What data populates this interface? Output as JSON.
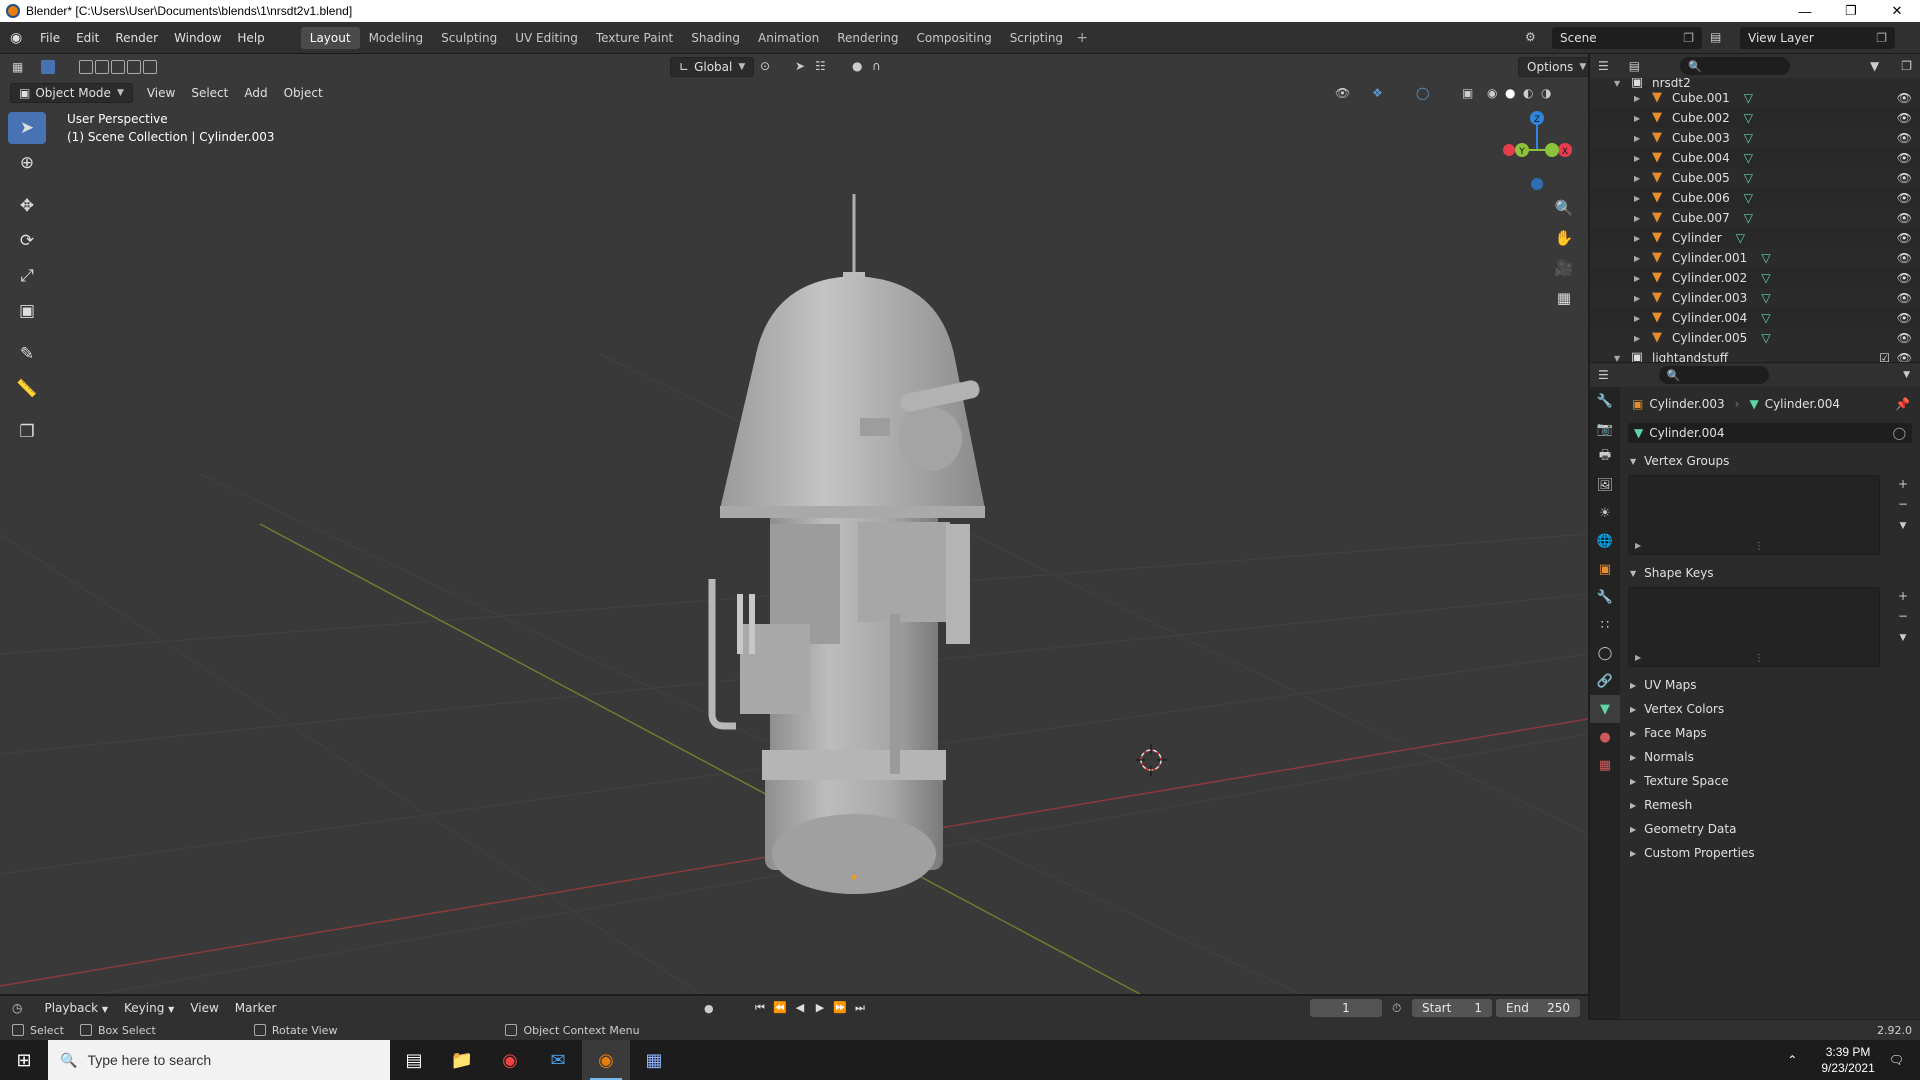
{
  "window": {
    "title": "Blender* [C:\\Users\\User\\Documents\\blends\\1\\nrsdt2v1.blend]"
  },
  "menu": [
    "File",
    "Edit",
    "Render",
    "Window",
    "Help"
  ],
  "workspaces": [
    "Layout",
    "Modeling",
    "Sculpting",
    "UV Editing",
    "Texture Paint",
    "Shading",
    "Animation",
    "Rendering",
    "Compositing",
    "Scripting"
  ],
  "active_workspace": "Layout",
  "scene": {
    "name": "Scene",
    "view_layer": "View Layer"
  },
  "viewport": {
    "mode": "Object Mode",
    "menus": [
      "View",
      "Select",
      "Add",
      "Object"
    ],
    "orientation": "Global",
    "options_label": "Options",
    "info_line1": "User Perspective",
    "info_line2": "(1) Scene Collection | Cylinder.003",
    "gizmo": {
      "x": "X",
      "y": "Y",
      "z": "Z"
    }
  },
  "outliner": {
    "collection_top": "nrsdt2",
    "items": [
      "Cube.001",
      "Cube.002",
      "Cube.003",
      "Cube.004",
      "Cube.005",
      "Cube.006",
      "Cube.007",
      "Cylinder",
      "Cylinder.001",
      "Cylinder.002",
      "Cylinder.003",
      "Cylinder.004",
      "Cylinder.005"
    ],
    "selected": "Cylinder.003",
    "collection_next": "lightandstuff"
  },
  "properties": {
    "object": "Cylinder.003",
    "mesh": "Cylinder.004",
    "mesh_field": "Cylinder.004",
    "panels_open": [
      "Vertex Groups",
      "Shape Keys"
    ],
    "panels_closed": [
      "UV Maps",
      "Vertex Colors",
      "Face Maps",
      "Normals",
      "Texture Space",
      "Remesh",
      "Geometry Data",
      "Custom Properties"
    ]
  },
  "timeline": {
    "menus": [
      "Playback",
      "Keying",
      "View",
      "Marker"
    ],
    "current_frame": "1",
    "start_label": "Start",
    "start": "1",
    "end_label": "End",
    "end": "250"
  },
  "statusbar": {
    "select": "Select",
    "box_select": "Box Select",
    "rotate_view": "Rotate View",
    "context_menu": "Object Context Menu",
    "version": "2.92.0"
  },
  "taskbar": {
    "search_placeholder": "Type here to search",
    "time": "3:39 PM",
    "date": "9/23/2021"
  },
  "colors": {
    "accent": "#4772b3",
    "object": "#e58e2d",
    "mesh": "#5fd6a3",
    "x_axis": "#e63e4f",
    "y_axis": "#8bc33a",
    "z_axis": "#2e86de"
  }
}
